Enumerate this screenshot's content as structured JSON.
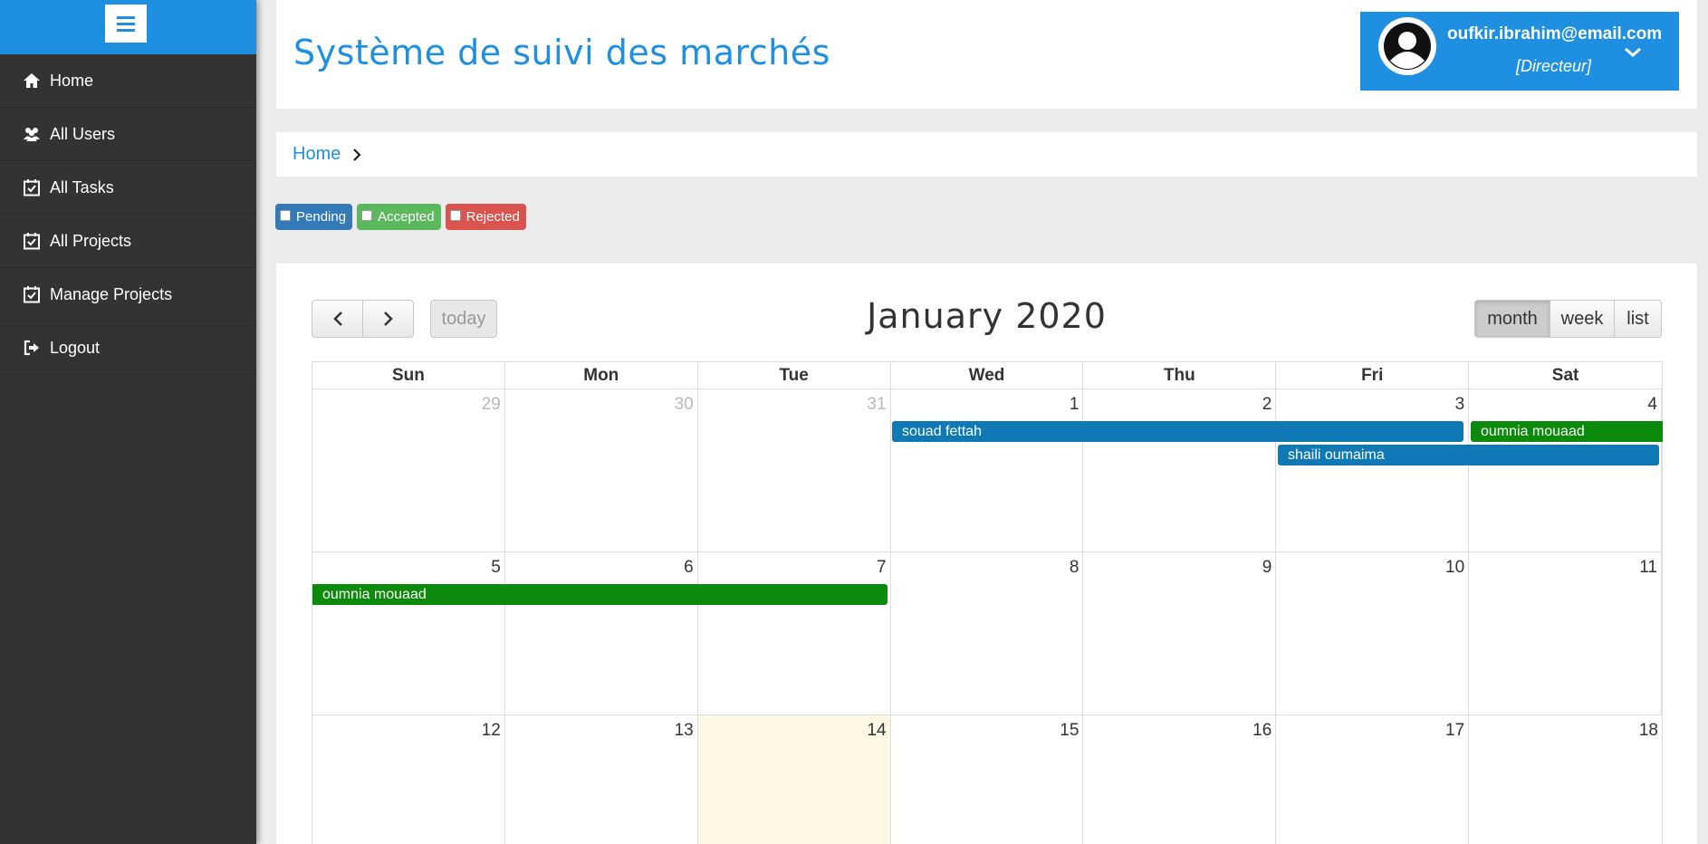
{
  "app": {
    "title": "Système de suivi des marchés"
  },
  "sidebar": {
    "items": [
      {
        "label": "Home",
        "icon": "home-icon"
      },
      {
        "label": "All Users",
        "icon": "users-icon"
      },
      {
        "label": "All Tasks",
        "icon": "calendar-check-icon"
      },
      {
        "label": "All Projects",
        "icon": "calendar-check-icon"
      },
      {
        "label": "Manage Projects",
        "icon": "calendar-check-icon"
      },
      {
        "label": "Logout",
        "icon": "logout-icon"
      }
    ]
  },
  "user": {
    "email": "oufkir.ibrahim@email.com",
    "role": "[Directeur]"
  },
  "breadcrumb": {
    "home": "Home"
  },
  "filters": {
    "pending": "Pending",
    "accepted": "Accepted",
    "rejected": "Rejected"
  },
  "calendar": {
    "title": "January 2020",
    "today_label": "today",
    "views": {
      "month": "month",
      "week": "week",
      "list": "list"
    },
    "active_view": "month",
    "weekdays": [
      "Sun",
      "Mon",
      "Tue",
      "Wed",
      "Thu",
      "Fri",
      "Sat"
    ],
    "weeks": [
      [
        "29",
        "30",
        "31",
        "1",
        "2",
        "3",
        "4"
      ],
      [
        "5",
        "6",
        "7",
        "8",
        "9",
        "10",
        "11"
      ],
      [
        "12",
        "13",
        "14",
        "15",
        "16",
        "17",
        "18"
      ]
    ],
    "events": [
      {
        "title": "souad fettah",
        "color": "#0f79b5"
      },
      {
        "title": "oumnia mouaad",
        "color": "#0b8a0b"
      },
      {
        "title": "shaili oumaima",
        "color": "#0f79b5"
      },
      {
        "title": "oumnia mouaad",
        "color": "#0b8a0b"
      }
    ]
  },
  "colors": {
    "accent": "#1e8fe1",
    "sidebar_bg": "#333333",
    "today_bg": "#fcf8e3"
  }
}
